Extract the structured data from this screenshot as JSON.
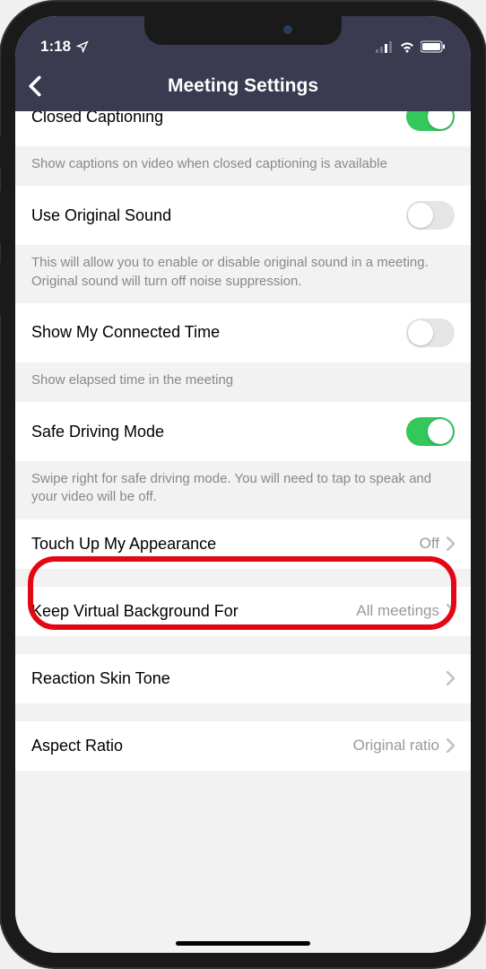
{
  "statusBar": {
    "time": "1:18"
  },
  "header": {
    "title": "Meeting Settings"
  },
  "settings": {
    "closedCaptioning": {
      "label": "Closed Captioning",
      "description": "Show captions on video when closed captioning is available",
      "on": true
    },
    "originalSound": {
      "label": "Use Original Sound",
      "description": "This will allow you to enable or disable original sound in a meeting. Original sound will turn off noise suppression.",
      "on": false
    },
    "connectedTime": {
      "label": "Show My Connected Time",
      "description": "Show elapsed time in the meeting",
      "on": false
    },
    "safeDriving": {
      "label": "Safe Driving Mode",
      "description": "Swipe right for safe driving mode. You will need to tap to speak and your video will be off.",
      "on": true
    },
    "touchUp": {
      "label": "Touch Up My Appearance",
      "value": "Off"
    },
    "virtualBackground": {
      "label": "Keep Virtual Background For",
      "value": "All meetings"
    },
    "reactionSkinTone": {
      "label": "Reaction Skin Tone",
      "value": ""
    },
    "aspectRatio": {
      "label": "Aspect Ratio",
      "value": "Original ratio"
    }
  }
}
